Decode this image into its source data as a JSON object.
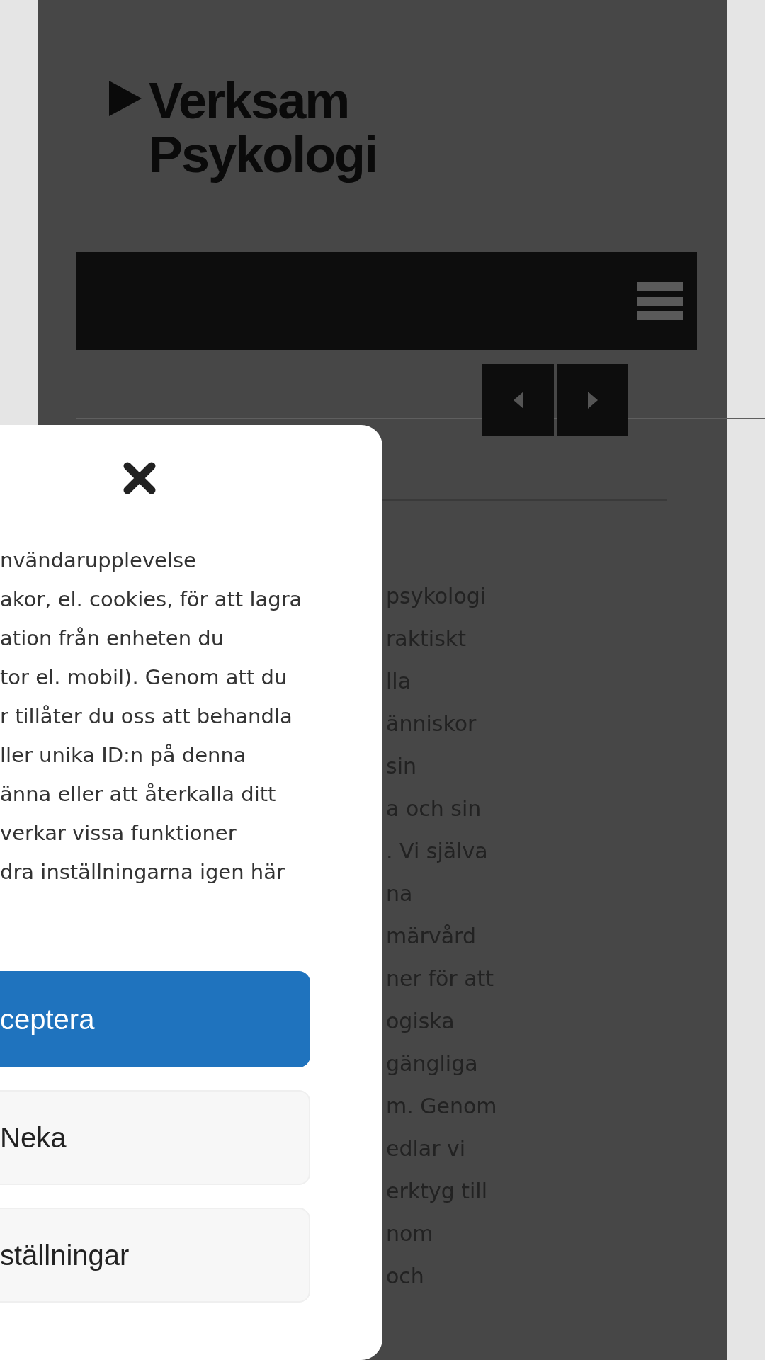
{
  "logo": {
    "lines": [
      "Verksam",
      "Psykologi"
    ]
  },
  "article": {
    "lines": [
      "psykologi",
      "raktiskt",
      "lla",
      "änniskor",
      "sin",
      "a och sin",
      ". Vi själva",
      "na",
      "märvård",
      "ner för att",
      "ogiska",
      "gängliga",
      "m. Genom",
      "edlar vi",
      "erktyg till",
      "nom",
      "och"
    ]
  },
  "cookie_dialog": {
    "text_lines": [
      "nvändarupplevelse",
      "akor, el. cookies, för att lagra",
      "ation från enheten du",
      "tor el. mobil). Genom att du",
      "r tillåter du oss att behandla",
      "ller unika ID:n på denna",
      "änna eller att återkalla ditt",
      "verkar vissa funktioner",
      "dra inställningarna igen här"
    ],
    "buttons": [
      {
        "label": "ceptera",
        "kind": "primary"
      },
      {
        "label": "Neka",
        "kind": "secondary"
      },
      {
        "label": "ställningar",
        "kind": "secondary"
      }
    ]
  }
}
